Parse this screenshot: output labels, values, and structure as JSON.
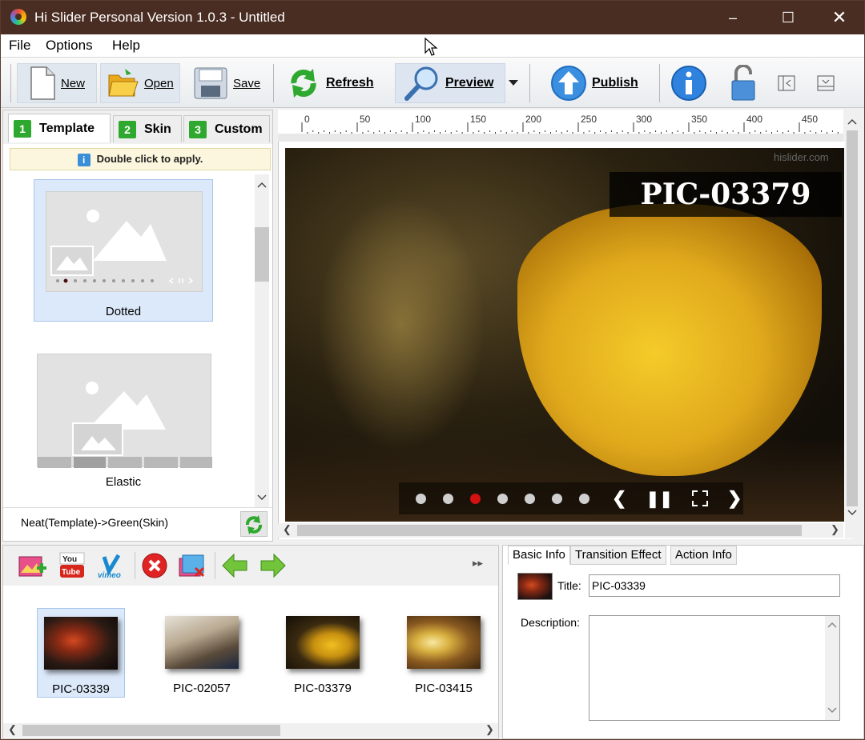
{
  "window": {
    "title": "Hi Slider Personal Version 1.0.3  - Untitled"
  },
  "menu": [
    "File",
    "Options",
    "Help"
  ],
  "toolbar": {
    "new": "New",
    "open": "Open",
    "save": "Save",
    "refresh": "Refresh",
    "preview": "Preview",
    "publish": "Publish"
  },
  "left_tabs": [
    {
      "num": "1",
      "label": "Template"
    },
    {
      "num": "2",
      "label": "Skin"
    },
    {
      "num": "3",
      "label": "Custom"
    }
  ],
  "hint": "Double click to apply.",
  "templates": [
    {
      "name": "Dotted"
    },
    {
      "name": "Elastic"
    }
  ],
  "status_text": "Neat(Template)->Green(Skin)",
  "ruler_labels": [
    "0",
    "50",
    "100",
    "150",
    "200",
    "250",
    "300",
    "350",
    "400",
    "450"
  ],
  "preview": {
    "title": "PIC-03379",
    "watermark": "hislider.com"
  },
  "slides": [
    {
      "name": "PIC-03339"
    },
    {
      "name": "PIC-02057"
    },
    {
      "name": "PIC-03379"
    },
    {
      "name": "PIC-03415"
    }
  ],
  "detail_tabs": [
    "Basic Info",
    "Transition Effect",
    "Action Info"
  ],
  "basic_info": {
    "title_label": "Title:",
    "title_value": "PIC-03339",
    "description_label": "Description:",
    "description_value": ""
  },
  "colors": {
    "titlebar": "#4a2d22",
    "accent_green": "#2fa82f",
    "active_dot": "#d31111"
  }
}
